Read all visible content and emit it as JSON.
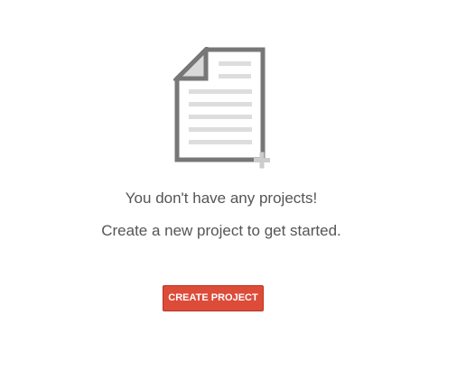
{
  "empty_state": {
    "icon": "new-document-icon",
    "title": "You don't have any projects!",
    "subtitle": "Create a new project to get started."
  },
  "actions": {
    "create_project_label": "CREATE PROJECT"
  },
  "colors": {
    "button_background": "#dd4b39",
    "icon_stroke": "#777777",
    "icon_lines": "#dddddd",
    "text": "#555555"
  }
}
